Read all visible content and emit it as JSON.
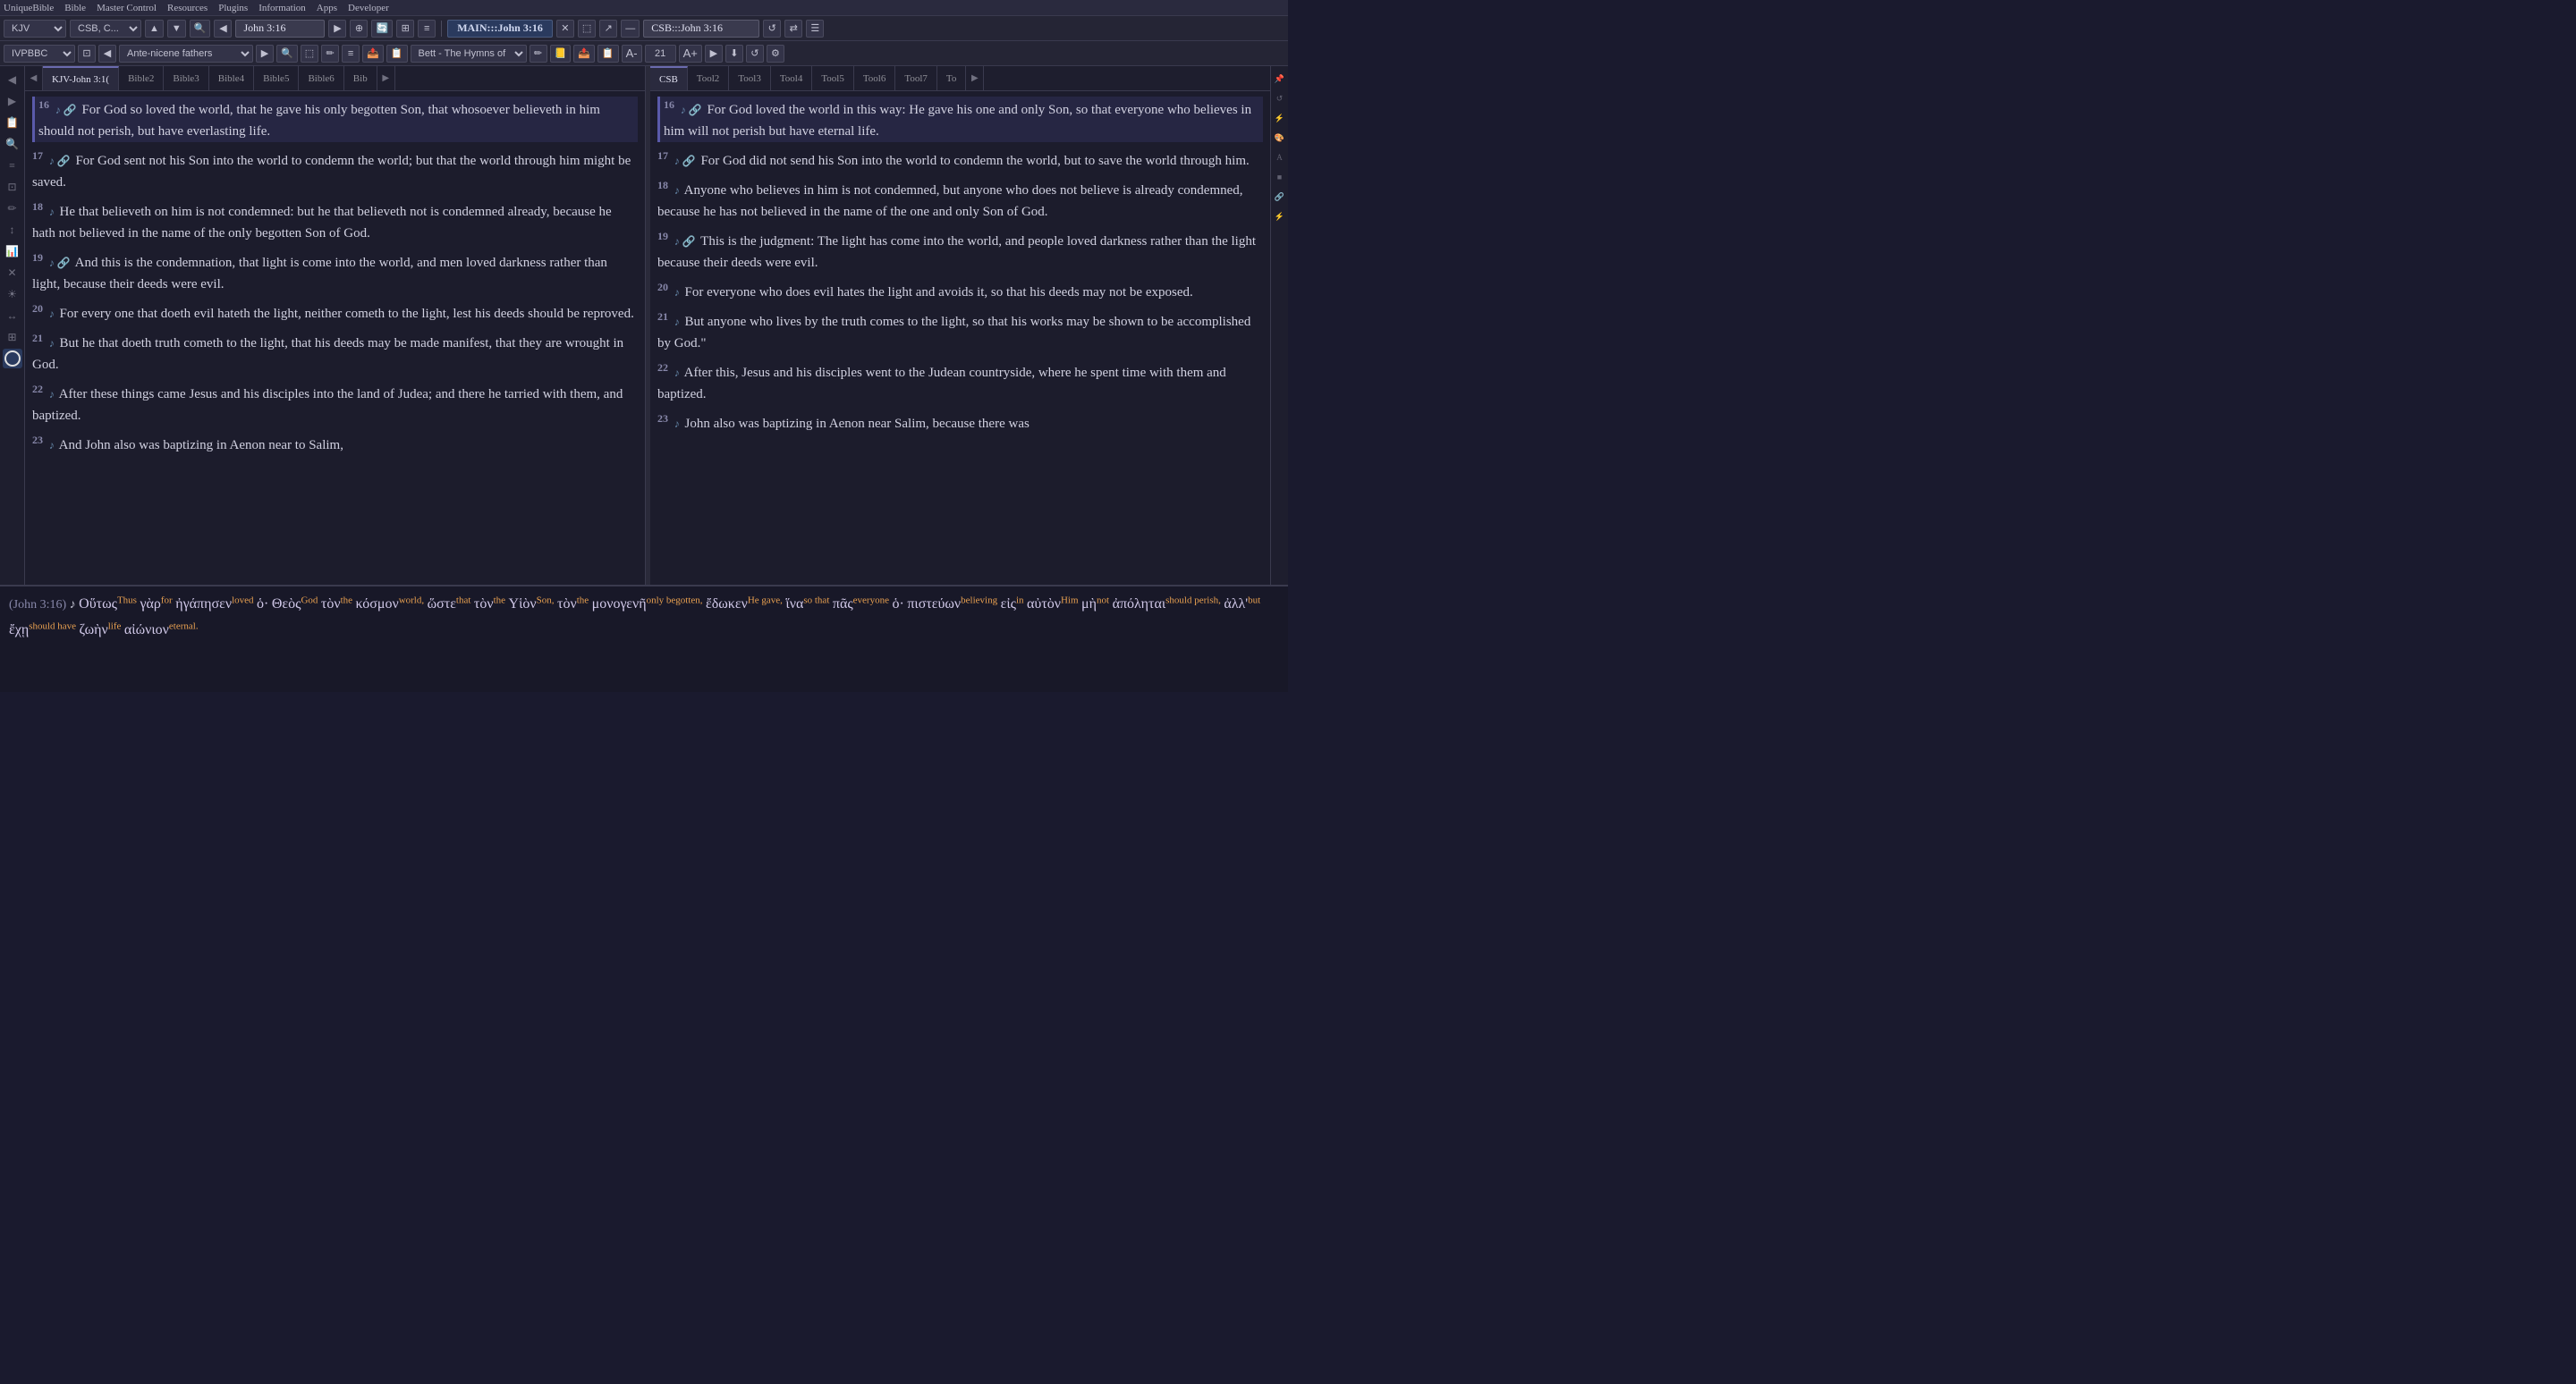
{
  "menubar": {
    "items": [
      "UniqueBible",
      "Bible",
      "Master Control",
      "Resources",
      "Plugins",
      "Information",
      "Apps",
      "Developer"
    ]
  },
  "toolbar1": {
    "version_select": "KJV",
    "commentary_select": "CSB, C...",
    "ref_input": "John 3:16",
    "main_ref": "MAIN:::John 3:16",
    "external_ref": "CSB:::John 3:16"
  },
  "toolbar2": {
    "module_select": "IVPBBC",
    "book_select": "Ante-nicene fathers",
    "hymn_select": "Bett - The Hymns of",
    "font_size": "21"
  },
  "left_tabs": [
    {
      "id": "kjv-john",
      "label": "KJV-John 3:1(",
      "active": true
    },
    {
      "id": "bible2",
      "label": "Bible2",
      "active": false
    },
    {
      "id": "bible3",
      "label": "Bible3",
      "active": false
    },
    {
      "id": "bible4",
      "label": "Bible4",
      "active": false
    },
    {
      "id": "bible5",
      "label": "Bible5",
      "active": false
    },
    {
      "id": "bible6",
      "label": "Bible6",
      "active": false
    },
    {
      "id": "bib-more",
      "label": "Bib",
      "active": false
    }
  ],
  "right_tabs": [
    {
      "id": "csb",
      "label": "CSB",
      "active": true
    },
    {
      "id": "tool2",
      "label": "Tool2",
      "active": false
    },
    {
      "id": "tool3",
      "label": "Tool3",
      "active": false
    },
    {
      "id": "tool4",
      "label": "Tool4",
      "active": false
    },
    {
      "id": "tool5",
      "label": "Tool5",
      "active": false
    },
    {
      "id": "tool6",
      "label": "Tool6",
      "active": false
    },
    {
      "id": "tool7",
      "label": "Tool7",
      "active": false
    },
    {
      "id": "to-more",
      "label": "To",
      "active": false
    }
  ],
  "left_verses": [
    {
      "num": "16",
      "icons": "♪ 🔗",
      "text": "For God so loved the world, that he gave his only begotten Son, that whosoever believeth in him should not perish, but have everlasting life.",
      "highlight": true
    },
    {
      "num": "17",
      "icons": "♪ 🔗",
      "text": "For God sent not his Son into the world to condemn the world; but that the world through him might be saved.",
      "highlight": false
    },
    {
      "num": "18",
      "icons": "♪",
      "text": "He that believeth on him is not condemned: but he that believeth not is condemned already, because he hath not believed in the name of the only begotten Son of God.",
      "highlight": false
    },
    {
      "num": "19",
      "icons": "♪ 🔗",
      "text": "And this is the condemnation, that light is come into the world, and men loved darkness rather than light, because their deeds were evil.",
      "highlight": false
    },
    {
      "num": "20",
      "icons": "♪",
      "text": "For every one that doeth evil hateth the light, neither cometh to the light, lest his deeds should be reproved.",
      "highlight": false
    },
    {
      "num": "21",
      "icons": "♪",
      "text": "But he that doeth truth cometh to the light, that his deeds may be made manifest, that they are wrought in God.",
      "highlight": false
    },
    {
      "num": "22",
      "icons": "♪",
      "text": "After these things came Jesus and his disciples into the land of Judea; and there he tarried with them, and baptized.",
      "highlight": false
    },
    {
      "num": "23",
      "icons": "♪",
      "text": "And John also was baptizing in Aenon near to Salim,",
      "highlight": false
    }
  ],
  "right_verses": [
    {
      "num": "16",
      "icons": "♪ 🔗",
      "text": "For God loved the world in this way: He gave his one and only Son, so that everyone who believes in him will not perish but have eternal life.",
      "highlight": true
    },
    {
      "num": "17",
      "icons": "♪ 🔗",
      "text": "For God did not send his Son into the world to condemn the world, but to save the world through him.",
      "highlight": false
    },
    {
      "num": "18",
      "icons": "♪",
      "text": "Anyone who believes in him is not condemned, but anyone who does not believe is already condemned, because he has not believed in the name of the one and only Son of God.",
      "highlight": false
    },
    {
      "num": "19",
      "icons": "♪ 🔗",
      "text": "This is the judgment: The light has come into the world, and people loved darkness rather than the light because their deeds were evil.",
      "highlight": false
    },
    {
      "num": "20",
      "icons": "♪",
      "text": "For everyone who does evil hates the light and avoids it, so that his deeds may not be exposed.",
      "highlight": false
    },
    {
      "num": "21",
      "icons": "♪",
      "text": "But anyone who lives by the truth comes to the light, so that his works may be shown to be accomplished by God.\"",
      "highlight": false
    },
    {
      "num": "22",
      "icons": "♪",
      "text": "After this, Jesus and his disciples went to the Judean countryside, where he spent time with them and baptized.",
      "highlight": false
    },
    {
      "num": "23",
      "icons": "♪",
      "text": "John also was baptizing in Aenon near Salim, because there was",
      "highlight": false
    }
  ],
  "bottom_panel": {
    "ref": "(John 3:16)",
    "greek_text": "Οὕτως Thus γὰρ for ἠγάπησεν loved ὁ· Θεὸς God τὸν the κόσμον world, ὥστε that τὸν the Υἱὸν Son, τὸν the μονογενῆ only begotten, ἔδωκεν He gave, ἵνα so that πᾶς everyone ὁ· πιστεύων believing εἰς in αὐτὸν Him μὴ not ἀπόληται should perish, ἀλλ' but ἔχῃ should have ζωὴν life αἰώνιον eternal."
  },
  "sidebar_left_icons": [
    "↑",
    "↓",
    "📋",
    "⚙",
    "≡",
    "🔍",
    "✏",
    "↕",
    "📊",
    "✕",
    "☀",
    "↔",
    "⊞",
    "🔘"
  ],
  "sidebar_right_icons": [
    "📌",
    "🔄",
    "⚡",
    "🎨",
    "🔤",
    "⬛",
    "📎",
    "⚡"
  ]
}
